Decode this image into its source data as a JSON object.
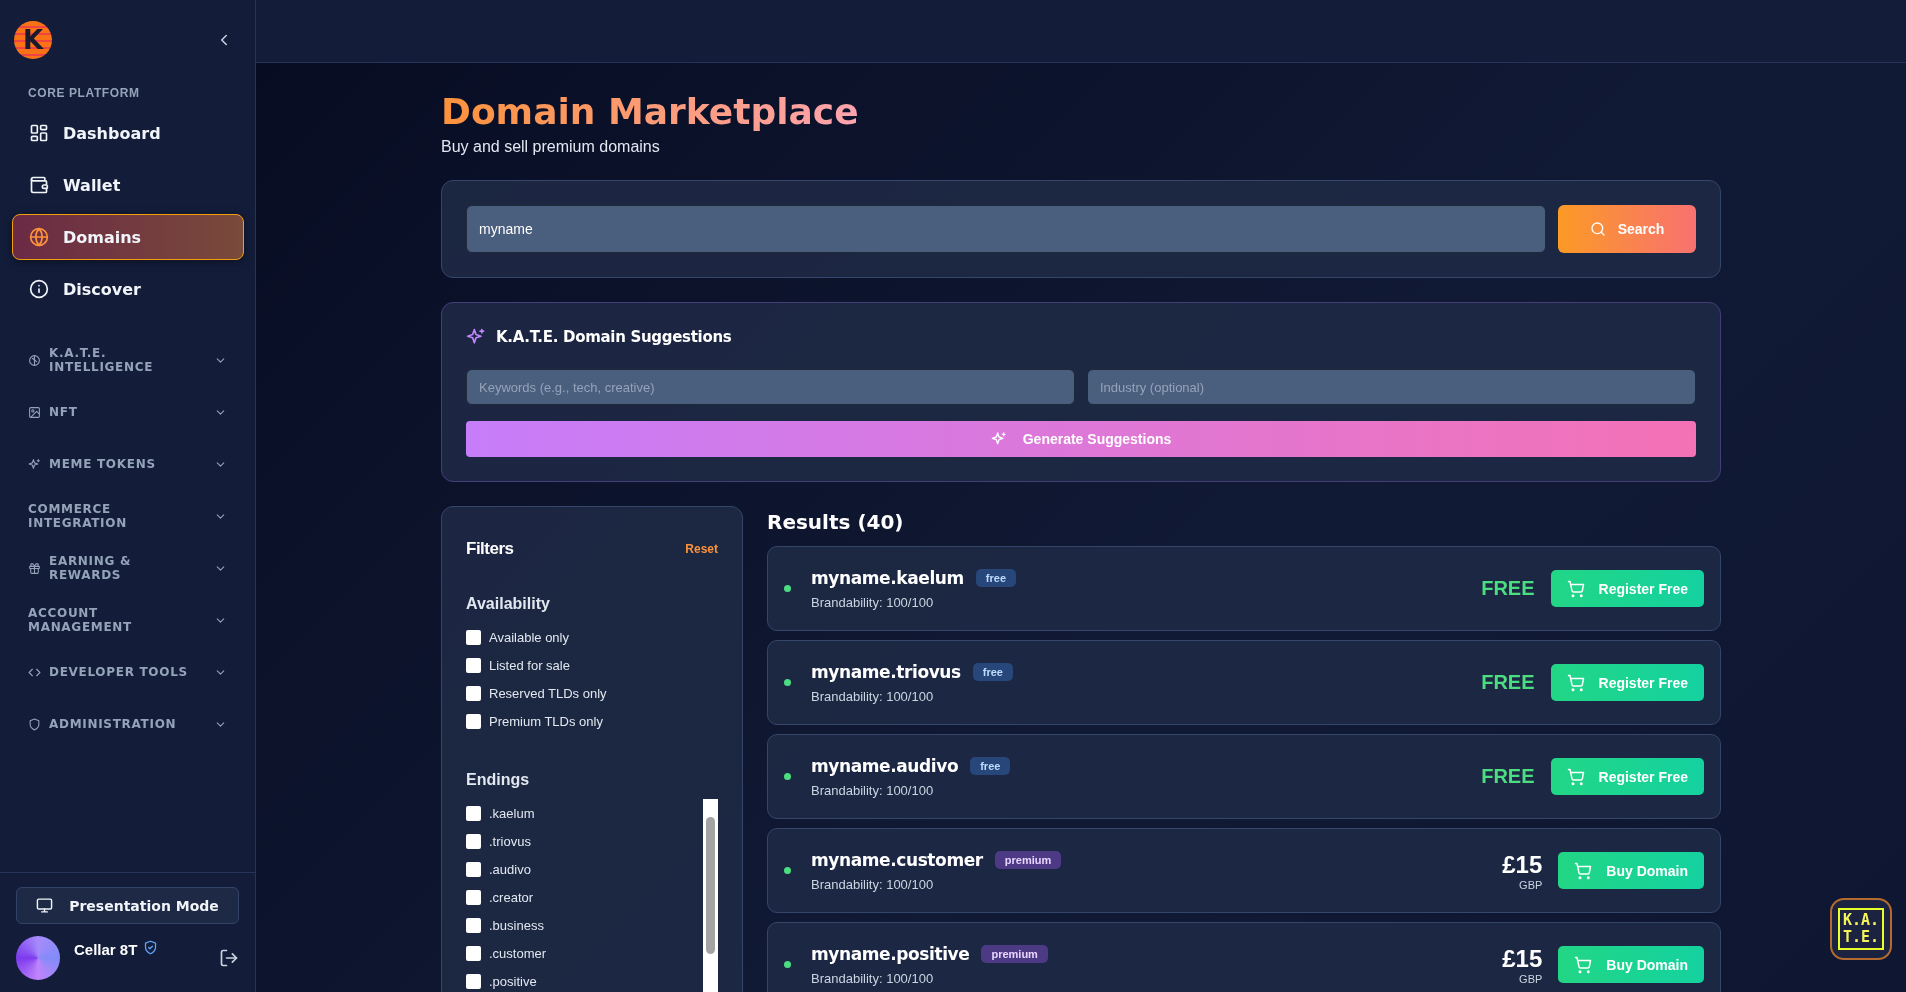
{
  "brand": {
    "mark": "K"
  },
  "sidebar": {
    "section_label": "CORE PLATFORM",
    "items": [
      {
        "label": "Dashboard",
        "selected": false
      },
      {
        "label": "Wallet",
        "selected": false
      },
      {
        "label": "Domains",
        "selected": true
      },
      {
        "label": "Discover",
        "selected": false
      }
    ],
    "groups": [
      {
        "label": "K.A.T.E. INTELLIGENCE",
        "expanded": false
      },
      {
        "label": "NFT",
        "expanded": false
      },
      {
        "label": "MEME TOKENS",
        "expanded": false
      },
      {
        "label": "COMMERCE INTEGRATION",
        "expanded": false
      },
      {
        "label": "EARNING & REWARDS",
        "expanded": false
      },
      {
        "label": "ACCOUNT MANAGEMENT",
        "expanded": false
      },
      {
        "label": "DEVELOPER TOOLS",
        "expanded": false
      },
      {
        "label": "ADMINISTRATION",
        "expanded": false
      }
    ],
    "presentation_button": "Presentation Mode",
    "user": {
      "name": "Cellar 8T",
      "verified": true
    }
  },
  "page": {
    "title": "Domain Marketplace",
    "subtitle": "Buy and sell premium domains"
  },
  "search": {
    "value": "myname",
    "button": "Search"
  },
  "suggestions": {
    "title": "K.A.T.E. Domain Suggestions",
    "keywords_placeholder": "Keywords (e.g., tech, creative)",
    "industry_placeholder": "Industry (optional)",
    "button": "Generate Suggestions"
  },
  "filters": {
    "title": "Filters",
    "reset": "Reset",
    "availability_title": "Availability",
    "availability": [
      {
        "label": "Available only",
        "checked": false
      },
      {
        "label": "Listed for sale",
        "checked": false
      },
      {
        "label": "Reserved TLDs only",
        "checked": false
      },
      {
        "label": "Premium TLDs only",
        "checked": false
      }
    ],
    "endings_title": "Endings",
    "endings": [
      {
        "label": ".kaelum",
        "checked": false
      },
      {
        "label": ".triovus",
        "checked": false
      },
      {
        "label": ".audivo",
        "checked": false
      },
      {
        "label": ".creator",
        "checked": false
      },
      {
        "label": ".business",
        "checked": false
      },
      {
        "label": ".customer",
        "checked": false
      },
      {
        "label": ".positive",
        "checked": false
      }
    ]
  },
  "results": {
    "title": "Results (40)",
    "items": [
      {
        "name": "myname.kaelum",
        "tag": "free",
        "kind": "free",
        "available": true,
        "brandability": "Brandability: 100/100",
        "price": "FREE",
        "button": "Register Free"
      },
      {
        "name": "myname.triovus",
        "tag": "free",
        "kind": "free",
        "available": true,
        "brandability": "Brandability: 100/100",
        "price": "FREE",
        "button": "Register Free"
      },
      {
        "name": "myname.audivo",
        "tag": "free",
        "kind": "free",
        "available": true,
        "brandability": "Brandability: 100/100",
        "price": "FREE",
        "button": "Register Free"
      },
      {
        "name": "myname.customer",
        "tag": "premium",
        "kind": "premium",
        "available": true,
        "brandability": "Brandability: 100/100",
        "price": "£15",
        "currency": "GBP",
        "button": "Buy Domain"
      },
      {
        "name": "myname.positive",
        "tag": "premium",
        "kind": "premium",
        "available": true,
        "brandability": "Brandability: 100/100",
        "price": "£15",
        "currency": "GBP",
        "button": "Buy Domain"
      }
    ]
  },
  "kate_badge": {
    "lines": [
      "K.A.",
      "T.E."
    ]
  }
}
